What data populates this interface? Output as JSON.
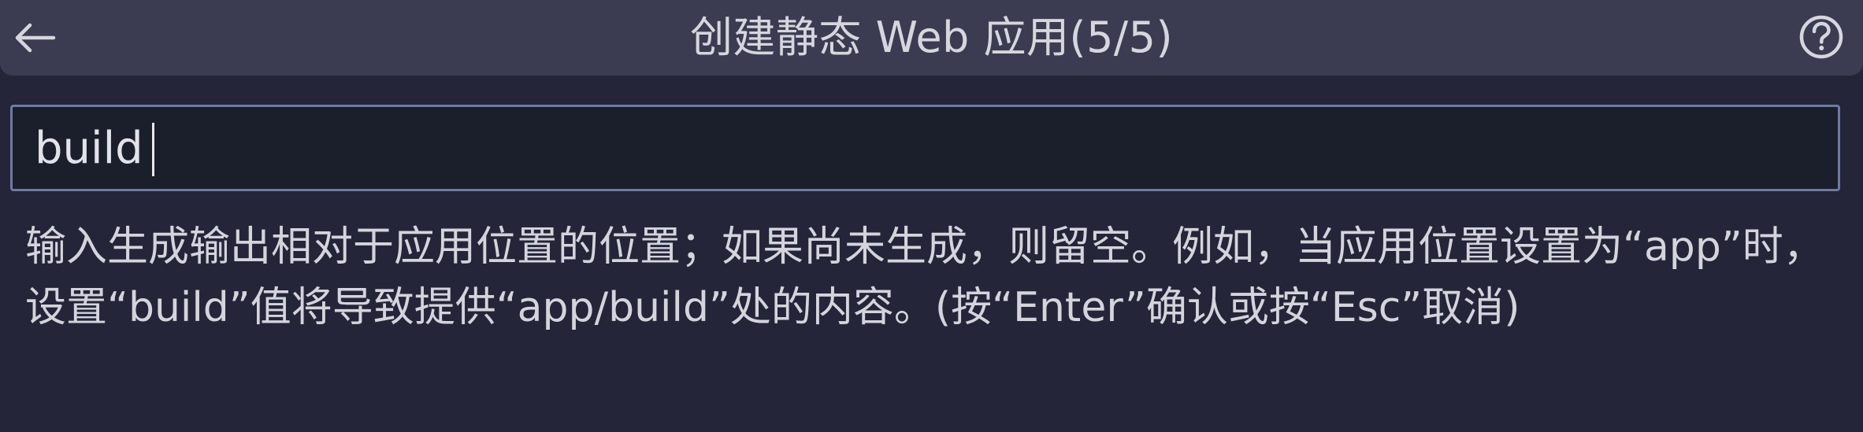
{
  "header": {
    "title": "创建静态 Web 应用(5/5)",
    "back_icon": "arrow-left-icon",
    "help_icon": "question-circle-icon"
  },
  "input": {
    "value": "build"
  },
  "message": {
    "text": "输入生成输出相对于应用位置的位置；如果尚未生成，则留空。例如，当应用位置设置为“app”时，设置“build”值将导致提供“app/build”处的内容。(按“Enter”确认或按“Esc”取消)"
  },
  "colors": {
    "background": "#242539",
    "titlebar": "#3b3c51",
    "input_background": "#1b1e2b",
    "input_border": "#6e7aa0",
    "text": "#d4d4dc"
  }
}
